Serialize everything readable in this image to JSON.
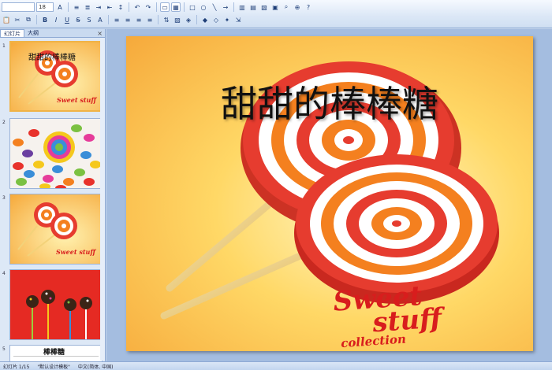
{
  "ribbon": {
    "font_size": "18",
    "tools_row1": [
      "paste-icon",
      "cut-icon",
      "copy-icon",
      "format-painter-icon"
    ],
    "align_hint": ""
  },
  "pane": {
    "tabs": [
      "幻灯片",
      "大纲"
    ],
    "close_glyph": "×",
    "thumbs": [
      {
        "num": "1",
        "title": "甜甜的棒棒糖",
        "sweet": "Sweet stuff"
      },
      {
        "num": "2"
      },
      {
        "num": "3",
        "sweet": "Sweet stuff"
      },
      {
        "num": "4"
      },
      {
        "num": "5",
        "title": "棒棒糖"
      }
    ]
  },
  "slide": {
    "title": "甜甜的棒棒糖",
    "sweet_line1": "Sweet",
    "sweet_line2": "stuff",
    "sweet_line3": "collection"
  },
  "status": {
    "slide_info": "幻灯片 1/15",
    "theme": "\"默认设计模板\"",
    "language": "中文(简体, 中国)"
  },
  "colors": {
    "accent_red": "#d81d1d",
    "slide_bg": "#ffd866",
    "selection": "#f0b347"
  }
}
